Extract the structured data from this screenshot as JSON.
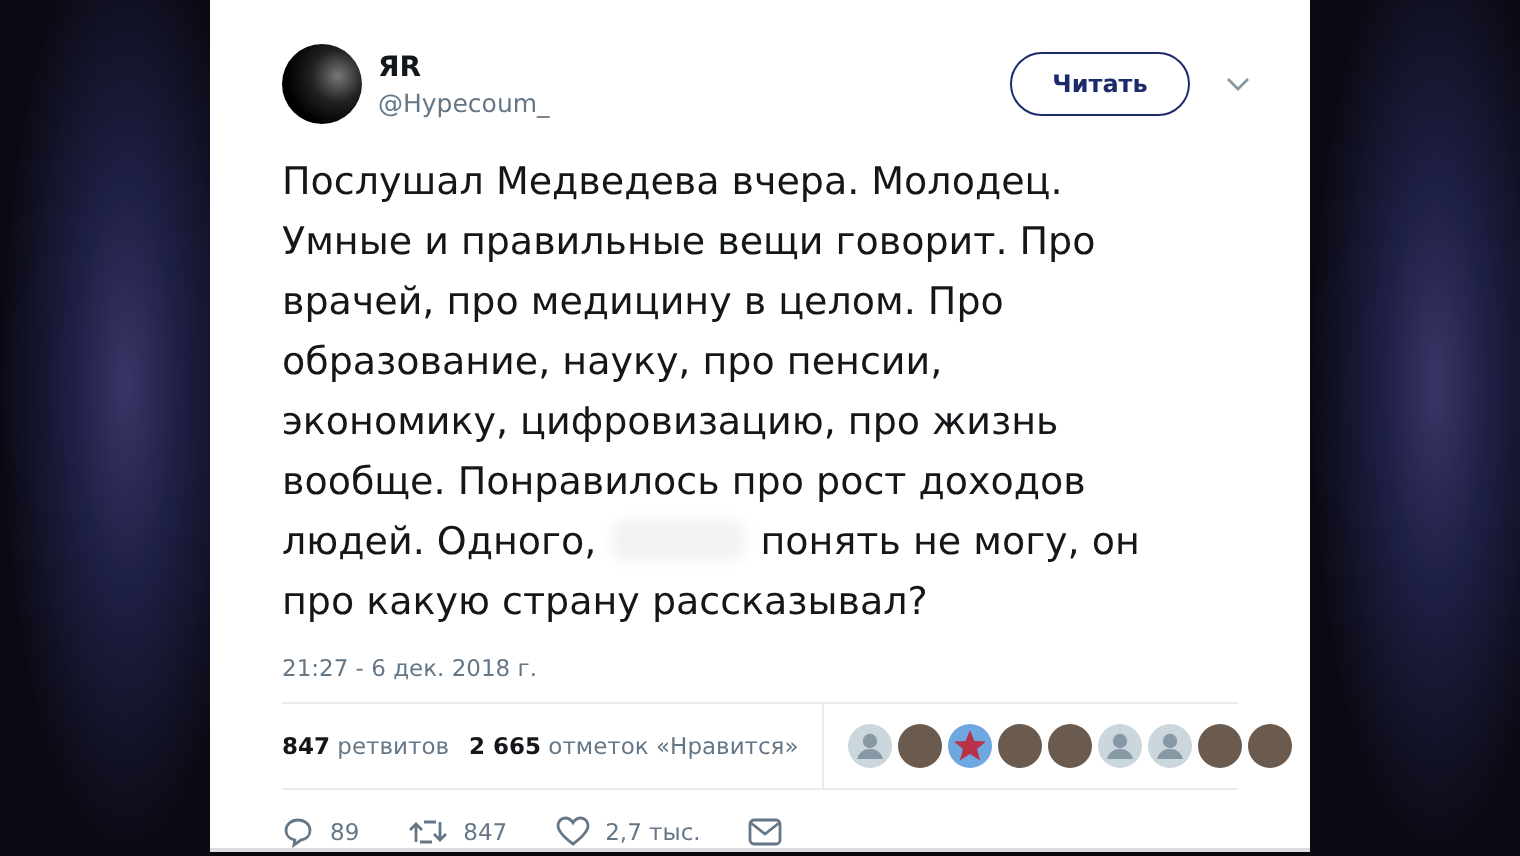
{
  "author": {
    "name": "ЯR",
    "handle": "@Hypecoum_"
  },
  "follow_button": {
    "label": "Читать"
  },
  "tweet": {
    "text_before": "Послушал Медведева вчера. Молодец. Умные и правильные вещи говорит. Про врачей, про медицину в целом. Про образование, науку, про пенсии, экономику, цифровизацию, про жизнь вообще. Понравилось про рост доходов людей. Одного,",
    "text_after": "понять не могу, он про какую страну рассказывал?"
  },
  "timestamp": "21:27 - 6 дек. 2018 г.",
  "stats": [
    {
      "count": "847",
      "label": "ретвитов"
    },
    {
      "count": "2 665",
      "label": "отметок «Нравится»"
    }
  ],
  "likers": [
    {
      "kind": "silhouette"
    },
    {
      "kind": "photo"
    },
    {
      "kind": "star"
    },
    {
      "kind": "photo"
    },
    {
      "kind": "photo"
    },
    {
      "kind": "silhouette"
    },
    {
      "kind": "silhouette"
    },
    {
      "kind": "photo"
    },
    {
      "kind": "photo"
    }
  ],
  "actions": [
    {
      "kind": "reply",
      "count": "89"
    },
    {
      "kind": "retweet",
      "count": "847"
    },
    {
      "kind": "like",
      "count": "2,7 тыс."
    },
    {
      "kind": "message"
    }
  ]
}
